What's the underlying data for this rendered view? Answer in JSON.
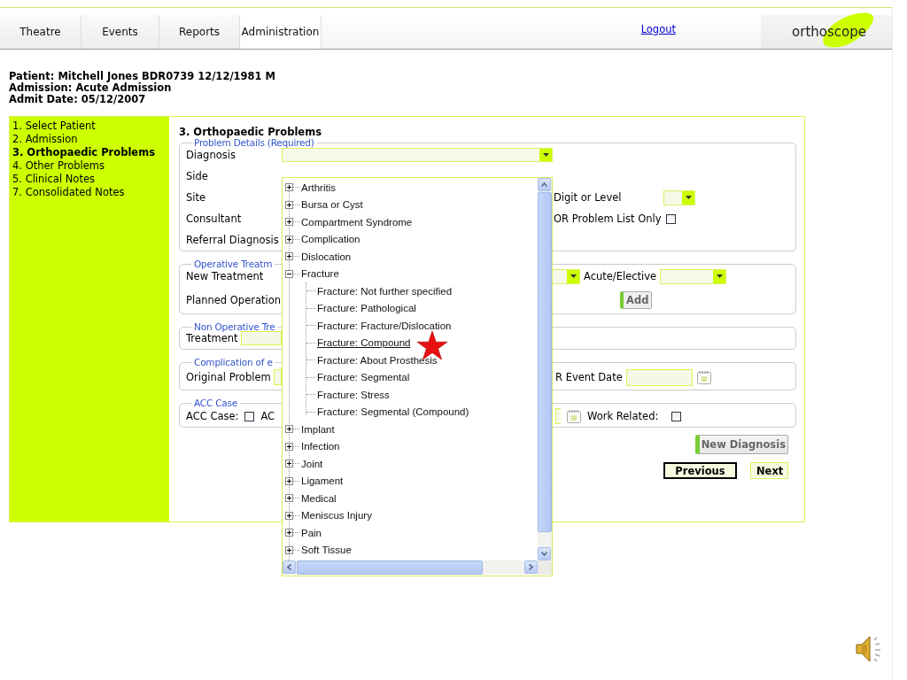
{
  "nav": {
    "tabs": [
      {
        "label": "Theatre",
        "selected": false
      },
      {
        "label": "Events",
        "selected": false
      },
      {
        "label": "Reports",
        "selected": false
      },
      {
        "label": "Administration",
        "selected": true
      }
    ],
    "logout": "Logout",
    "logo": "orthoscope"
  },
  "patient": [
    "Patient: Mitchell Jones BDR0739 12/12/1981 M",
    "Admission: Acute Admission",
    "Admit Date: 05/12/2007"
  ],
  "steps": [
    {
      "label": "1. Select Patient",
      "selected": false
    },
    {
      "label": "2. Admission",
      "selected": false
    },
    {
      "label": "3. Orthopaedic Problems",
      "selected": true
    },
    {
      "label": "4. Other Problems",
      "selected": false
    },
    {
      "label": "5. Clinical Notes",
      "selected": false
    },
    {
      "label": "7. Consolidated Notes",
      "selected": false
    }
  ],
  "section_title": "3. Orthopaedic Problems",
  "problem_details": {
    "legend": "Problem Details (Required)",
    "labels": [
      "Diagnosis",
      "Side",
      "Site",
      "Consultant",
      "Referral Diagnosis"
    ],
    "digit_label": "Digit or Level",
    "or_list_label": "OR Problem List Only",
    "or_list_checked": false
  },
  "operative": {
    "legend": "Operative Treatm",
    "new_treatment": "New Treatment",
    "planned_operation": "Planned Operation",
    "acute_label": "Acute/Elective",
    "add_button": "Add"
  },
  "non_operative": {
    "legend": "Non Operative Tre",
    "treatment": "Treatment"
  },
  "complication": {
    "legend": "Complication of e",
    "original_problem": "Original Problem",
    "event_date": "R Event Date"
  },
  "acc": {
    "legend": "ACC Case",
    "acc_case": "ACC Case:",
    "acc_case_checked": false,
    "column_2": "AC",
    "work_related": "Work Related:",
    "work_related_checked": false
  },
  "buttons": {
    "new_diagnosis": "New Diagnosis",
    "previous": "Previous",
    "next": "Next"
  },
  "diagnosis_dropdown": {
    "items": [
      {
        "label": "Arthritis",
        "expanded": false
      },
      {
        "label": "Bursa or Cyst",
        "expanded": false
      },
      {
        "label": "Compartment Syndrome",
        "expanded": false
      },
      {
        "label": "Complication",
        "expanded": false
      },
      {
        "label": "Dislocation",
        "expanded": false
      },
      {
        "label": "Fracture",
        "expanded": true,
        "children": [
          {
            "label": "Fracture: Not further specified",
            "highlighted": false
          },
          {
            "label": "Fracture: Pathological",
            "highlighted": false
          },
          {
            "label": "Fracture: Fracture/Dislocation",
            "highlighted": false
          },
          {
            "label": "Fracture: Compound",
            "highlighted": true
          },
          {
            "label": "Fracture: About Prosthesis",
            "highlighted": false
          },
          {
            "label": "Fracture: Segmental",
            "highlighted": false
          },
          {
            "label": "Fracture: Stress",
            "highlighted": false
          },
          {
            "label": "Fracture: Segmental (Compound)",
            "highlighted": false
          }
        ]
      },
      {
        "label": "Implant",
        "expanded": false
      },
      {
        "label": "Infection",
        "expanded": false
      },
      {
        "label": "Joint",
        "expanded": false
      },
      {
        "label": "Ligament",
        "expanded": false
      },
      {
        "label": "Medical",
        "expanded": false
      },
      {
        "label": "Meniscus Injury",
        "expanded": false
      },
      {
        "label": "Pain",
        "expanded": false
      },
      {
        "label": "Soft Tissue",
        "expanded": false
      }
    ]
  }
}
